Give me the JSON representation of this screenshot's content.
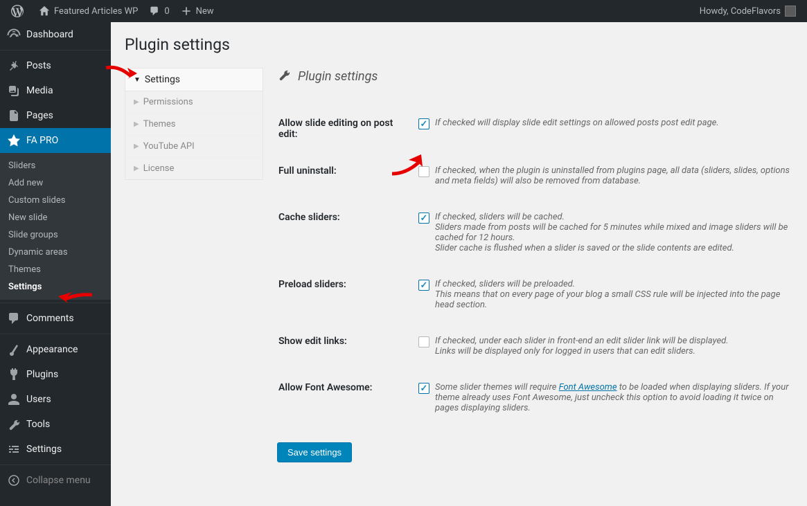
{
  "adminbar": {
    "site_name": "Featured Articles WP",
    "comments_count": "0",
    "new_label": "New",
    "howdy_prefix": "Howdy, ",
    "username": "CodeFlavors"
  },
  "adminmenu": {
    "dashboard": "Dashboard",
    "posts": "Posts",
    "media": "Media",
    "pages": "Pages",
    "fa_pro": "FA PRO",
    "fa_sub": {
      "sliders": "Sliders",
      "add_new": "Add new",
      "custom_slides": "Custom slides",
      "new_slide": "New slide",
      "slide_groups": "Slide groups",
      "dynamic_areas": "Dynamic areas",
      "themes": "Themes",
      "settings": "Settings"
    },
    "comments": "Comments",
    "appearance": "Appearance",
    "plugins": "Plugins",
    "users": "Users",
    "tools": "Tools",
    "settings": "Settings",
    "collapse": "Collapse menu"
  },
  "page": {
    "title": "Plugin settings",
    "sidepanel": {
      "settings": "Settings",
      "permissions": "Permissions",
      "themes": "Themes",
      "youtube": "YouTube API",
      "license": "License"
    },
    "section_title": "Plugin settings",
    "rows": {
      "allow_slide_edit": {
        "label": "Allow slide editing on post edit:",
        "desc": "If checked will display slide edit settings on allowed posts post edit page.",
        "checked": true
      },
      "full_uninstall": {
        "label": "Full uninstall:",
        "desc": "If checked, when the plugin is uninstalled from plugins page, all data (sliders, slides, options and meta fields) will also be removed from database.",
        "checked": false
      },
      "cache_sliders": {
        "label": "Cache sliders:",
        "desc1": "If checked, sliders will be cached.",
        "desc2": "Sliders made from posts will be cached for 5 minutes while mixed and image sliders will be cached for 12 hours.",
        "desc3": "Slider cache is flushed when a slider is saved or the slide contents are edited.",
        "checked": true
      },
      "preload_sliders": {
        "label": "Preload sliders:",
        "desc1": "If checked, sliders will be preloaded.",
        "desc2": "This means that on every page of your blog a small CSS rule will be injected into the page head section.",
        "checked": true
      },
      "show_edit_links": {
        "label": "Show edit links:",
        "desc1": "If checked, under each slider in front-end an edit slider link will be displayed.",
        "desc2": "Links will be displayed only for logged in users that can edit sliders.",
        "checked": false
      },
      "allow_fa": {
        "label": "Allow Font Awesome:",
        "desc_pre": "Some slider themes will require ",
        "desc_link": "Font Awesome",
        "desc_post": " to be loaded when displaying sliders. If your theme already uses Font Awesome, just uncheck this option to avoid loading it twice on pages displaying sliders.",
        "checked": true
      }
    },
    "save_button": "Save settings"
  }
}
